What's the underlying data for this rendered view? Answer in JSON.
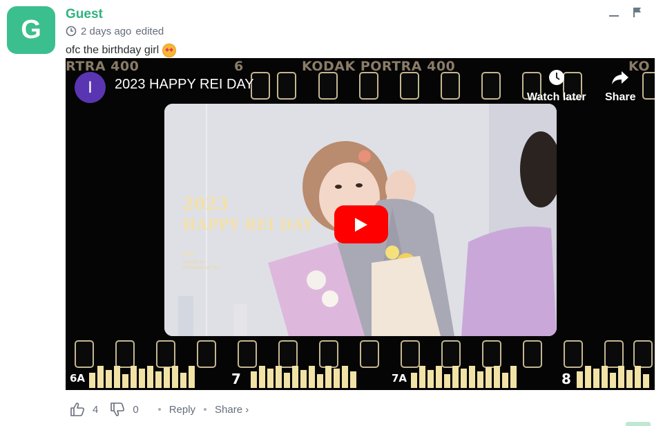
{
  "comment": {
    "avatar_letter": "G",
    "author": "Guest",
    "time": "2 days ago",
    "edited": "edited",
    "text": "ofc the birthday girl",
    "emoji": "smiling-face-with-hearts"
  },
  "video": {
    "channel_initial": "I",
    "title": "2023 HAPPY REI DAY",
    "watch_later": "Watch later",
    "share": "Share",
    "film_labels": {
      "left": "RTRA 400",
      "frame_six": "6",
      "brand": "KODAK PORTRA 400",
      "right_cut": "KO"
    },
    "overlay_year": "2023",
    "overlay_title": "HAPPY REI DAY",
    "overlay_credit_1": "FILM BY lux",
    "overlay_credit_2": "STARRING IVE REI",
    "frame_numbers": {
      "a": "6A",
      "b": "7",
      "c": "7A",
      "d": "8"
    }
  },
  "actions": {
    "upvotes": "4",
    "downvotes": "0",
    "reply": "Reply",
    "share": "Share ›"
  },
  "colors": {
    "brand_green": "#2fb37f",
    "avatar": "#3bbf8e",
    "yt_red": "#ff0000",
    "channel": "#5a35b1"
  }
}
